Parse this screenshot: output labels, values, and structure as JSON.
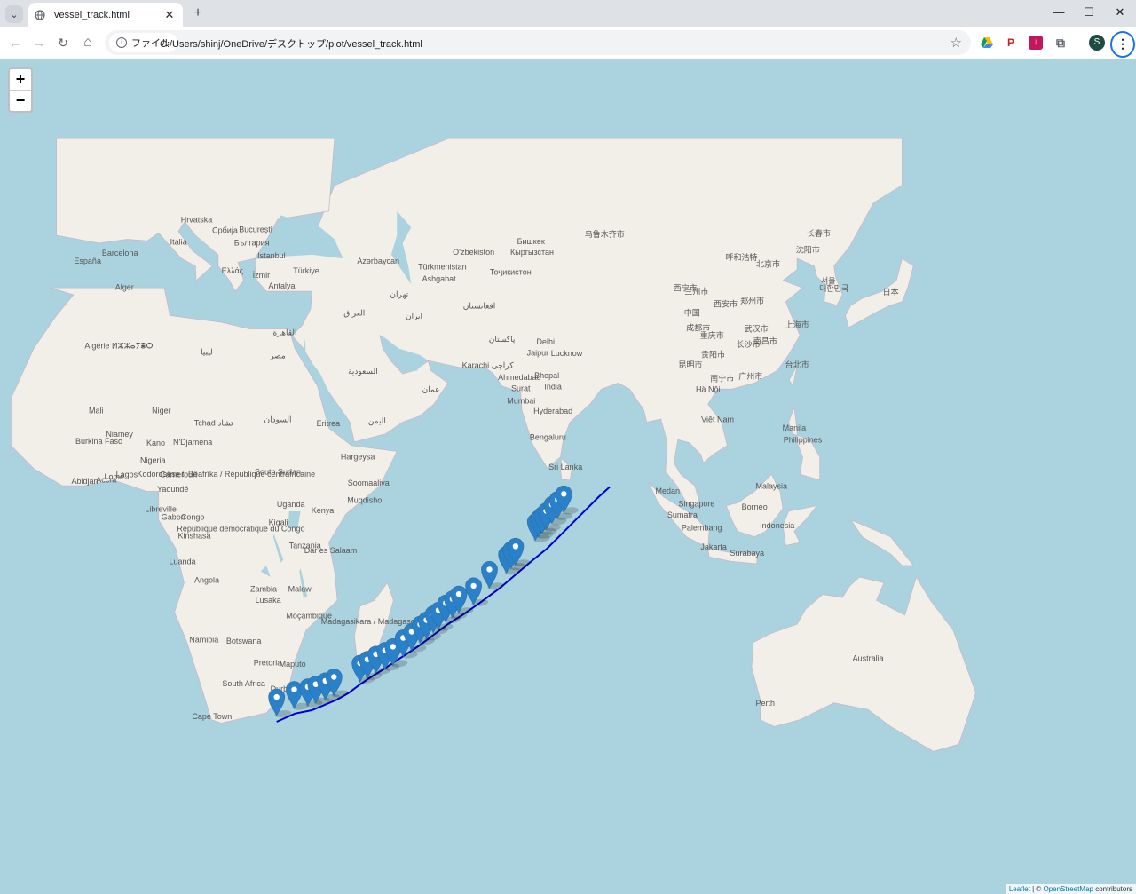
{
  "browser": {
    "tab_title": "vessel_track.html",
    "tab_close": "✕",
    "new_tab": "+",
    "tab_list": "⌄",
    "minimize": "—",
    "maximize": "☐",
    "close": "✕",
    "nav": {
      "back": "←",
      "forward": "→",
      "reload": "↻",
      "home": "⌂"
    },
    "chip_label": "ファイル",
    "url": "C:/Users/shinj/OneDrive/デスクトップ/plot/vessel_track.html",
    "star": "☆",
    "profile_initial": "S",
    "menu": "⋮"
  },
  "map": {
    "zoom_in": "+",
    "zoom_out": "−",
    "attribution": {
      "leaflet": "Leaflet",
      "sep": " | © ",
      "osm": "OpenStreetMap",
      "rest": " contributors"
    },
    "track_color": "#0000cc",
    "marker_color": "#2a81cb",
    "track": [
      {
        "lat": -34.3,
        "lon": 29.8
      },
      {
        "lat": -33.1,
        "lon": 33.0
      },
      {
        "lat": -32.6,
        "lon": 36.0
      },
      {
        "lat": -31.9,
        "lon": 38.0
      },
      {
        "lat": -31.0,
        "lon": 40.5
      },
      {
        "lat": -30.0,
        "lon": 42.5
      },
      {
        "lat": -28.7,
        "lon": 44.5
      },
      {
        "lat": -27.5,
        "lon": 46.5
      },
      {
        "lat": -26.4,
        "lon": 48.5
      },
      {
        "lat": -25.2,
        "lon": 50.5
      },
      {
        "lat": -24.0,
        "lon": 52.5
      },
      {
        "lat": -22.8,
        "lon": 54.5
      },
      {
        "lat": -21.6,
        "lon": 56.3
      },
      {
        "lat": -20.4,
        "lon": 58.0
      },
      {
        "lat": -19.0,
        "lon": 60.0
      },
      {
        "lat": -17.5,
        "lon": 62.5
      },
      {
        "lat": -15.5,
        "lon": 65.5
      },
      {
        "lat": -13.0,
        "lon": 69.0
      },
      {
        "lat": -10.5,
        "lon": 72.0
      },
      {
        "lat": -8.0,
        "lon": 75.0
      },
      {
        "lat": -6.0,
        "lon": 77.5
      },
      {
        "lat": -3.0,
        "lon": 80.5
      },
      {
        "lat": -1.0,
        "lon": 82.5
      },
      {
        "lat": 1.0,
        "lon": 84.5
      },
      {
        "lat": 3.0,
        "lon": 86.5
      },
      {
        "lat": 4.8,
        "lon": 88.5
      }
    ],
    "markers": [
      {
        "lat": -33.4,
        "lon": 29.8
      },
      {
        "lat": -32.3,
        "lon": 32.9
      },
      {
        "lat": -31.9,
        "lon": 35.3
      },
      {
        "lat": -31.5,
        "lon": 36.7
      },
      {
        "lat": -31.0,
        "lon": 38.4
      },
      {
        "lat": -30.4,
        "lon": 39.9
      },
      {
        "lat": -28.3,
        "lon": 44.5
      },
      {
        "lat": -27.7,
        "lon": 45.8
      },
      {
        "lat": -26.9,
        "lon": 47.3
      },
      {
        "lat": -26.3,
        "lon": 48.9
      },
      {
        "lat": -25.7,
        "lon": 50.3
      },
      {
        "lat": -24.3,
        "lon": 52.1
      },
      {
        "lat": -23.3,
        "lon": 53.6
      },
      {
        "lat": -22.1,
        "lon": 55.1
      },
      {
        "lat": -21.4,
        "lon": 56.2
      },
      {
        "lat": -20.4,
        "lon": 57.4
      },
      {
        "lat": -19.8,
        "lon": 58.3
      },
      {
        "lat": -18.6,
        "lon": 59.6
      },
      {
        "lat": -17.9,
        "lon": 60.8
      },
      {
        "lat": -17.1,
        "lon": 61.9
      },
      {
        "lat": -15.7,
        "lon": 64.5
      },
      {
        "lat": -12.9,
        "lon": 67.3
      },
      {
        "lat": -10.3,
        "lon": 70.3
      },
      {
        "lat": -9.5,
        "lon": 71.1
      },
      {
        "lat": -8.9,
        "lon": 71.9
      },
      {
        "lat": -4.6,
        "lon": 75.4
      },
      {
        "lat": -4.0,
        "lon": 76.0
      },
      {
        "lat": -3.4,
        "lon": 76.6
      },
      {
        "lat": -2.7,
        "lon": 77.3
      },
      {
        "lat": -1.6,
        "lon": 78.3
      },
      {
        "lat": -0.7,
        "lon": 79.3
      },
      {
        "lat": 0.3,
        "lon": 80.4
      }
    ],
    "labels": [
      {
        "t": "España",
        "lat": 40.3,
        "lon": -3.5
      },
      {
        "t": "Barcelona",
        "lat": 41.4,
        "lon": 2.2
      },
      {
        "t": "Italia",
        "lat": 42.8,
        "lon": 12.5
      },
      {
        "t": "Hrvatska",
        "lat": 45.6,
        "lon": 15.7
      },
      {
        "t": "Србија",
        "lat": 44.3,
        "lon": 20.7
      },
      {
        "t": "Bucureşti",
        "lat": 44.4,
        "lon": 26.1
      },
      {
        "t": "България",
        "lat": 42.7,
        "lon": 25.4
      },
      {
        "t": "Istanbul",
        "lat": 41.0,
        "lon": 28.9
      },
      {
        "t": "Ελλάς",
        "lat": 39.0,
        "lon": 22.0
      },
      {
        "t": "İzmir",
        "lat": 38.4,
        "lon": 27.1
      },
      {
        "t": "Antalya",
        "lat": 36.9,
        "lon": 30.7
      },
      {
        "t": "Türkiye",
        "lat": 39.0,
        "lon": 35.0
      },
      {
        "t": "Azərbaycan",
        "lat": 40.3,
        "lon": 47.7
      },
      {
        "t": "Türkmenistan",
        "lat": 39.5,
        "lon": 59.0
      },
      {
        "t": "Oʻzbekiston",
        "lat": 41.5,
        "lon": 64.5
      },
      {
        "t": "Ashgabat",
        "lat": 37.9,
        "lon": 58.4
      },
      {
        "t": "Тоҷикистон",
        "lat": 38.8,
        "lon": 71.0
      },
      {
        "t": "Кыргызстан",
        "lat": 41.5,
        "lon": 74.8
      },
      {
        "t": "Бишкек",
        "lat": 42.9,
        "lon": 74.6
      },
      {
        "t": "Alger",
        "lat": 36.7,
        "lon": 3.0
      },
      {
        "t": "Algérie ⵍⵣⵣⴰⵢⴻⵔ",
        "lat": 28.0,
        "lon": 2.0
      },
      {
        "t": "Mali",
        "lat": 17.5,
        "lon": -2.0
      },
      {
        "t": "Niger",
        "lat": 17.5,
        "lon": 9.5
      },
      {
        "t": "Niamey",
        "lat": 13.5,
        "lon": 2.1
      },
      {
        "t": "Burkina Faso",
        "lat": 12.3,
        "lon": -1.5
      },
      {
        "t": "Kano",
        "lat": 12.0,
        "lon": 8.5
      },
      {
        "t": "N'Djaména",
        "lat": 12.1,
        "lon": 15.0
      },
      {
        "t": "Tchad تشاد",
        "lat": 15.4,
        "lon": 18.7
      },
      {
        "t": "Nigeria",
        "lat": 9.0,
        "lon": 8.0
      },
      {
        "t": "Lagos",
        "lat": 6.5,
        "lon": 3.4
      },
      {
        "t": "Lomé",
        "lat": 6.1,
        "lon": 1.2
      },
      {
        "t": "Accra",
        "lat": 5.6,
        "lon": -0.2
      },
      {
        "t": "Abidjan",
        "lat": 5.3,
        "lon": -4.0
      },
      {
        "t": "Cameroun",
        "lat": 6.5,
        "lon": 12.5
      },
      {
        "t": "Yaoundé",
        "lat": 3.9,
        "lon": 11.5
      },
      {
        "t": "Libreville",
        "lat": 0.4,
        "lon": 9.4
      },
      {
        "t": "Gabon",
        "lat": -1.0,
        "lon": 11.6
      },
      {
        "t": "Congo",
        "lat": -1.0,
        "lon": 15.0
      },
      {
        "t": "Kinshasa",
        "lat": -4.3,
        "lon": 15.3
      },
      {
        "t": "Luanda",
        "lat": -8.8,
        "lon": 13.2
      },
      {
        "t": "Angola",
        "lat": -12.0,
        "lon": 17.5
      },
      {
        "t": "Zambia",
        "lat": -13.5,
        "lon": 27.5
      },
      {
        "t": "Lusaka",
        "lat": -15.4,
        "lon": 28.3
      },
      {
        "t": "Malawi",
        "lat": -13.5,
        "lon": 34.0
      },
      {
        "t": "Moçambique",
        "lat": -18.0,
        "lon": 35.5
      },
      {
        "t": "Namibia",
        "lat": -22.0,
        "lon": 17.0
      },
      {
        "t": "Botswana",
        "lat": -22.2,
        "lon": 24.0
      },
      {
        "t": "Pretoria",
        "lat": -25.7,
        "lon": 28.2
      },
      {
        "t": "Maputo",
        "lat": -25.9,
        "lon": 32.6
      },
      {
        "t": "South Africa",
        "lat": -29.0,
        "lon": 24.0
      },
      {
        "t": "Durban",
        "lat": -29.8,
        "lon": 31.0
      },
      {
        "t": "Cape Town",
        "lat": -33.9,
        "lon": 18.4
      },
      {
        "t": "Madagasikara / Madagascar",
        "lat": -19.0,
        "lon": 46.5
      },
      {
        "t": "Kigali",
        "lat": -1.9,
        "lon": 30.1
      },
      {
        "t": "Tanzania",
        "lat": -6.0,
        "lon": 34.8
      },
      {
        "t": "Dar es Salaam",
        "lat": -6.8,
        "lon": 39.3
      },
      {
        "t": "Kenya",
        "lat": 0.2,
        "lon": 37.9
      },
      {
        "t": "Uganda",
        "lat": 1.3,
        "lon": 32.3
      },
      {
        "t": "South Sudan",
        "lat": 7.0,
        "lon": 30.0
      },
      {
        "t": "Eritrea",
        "lat": 15.3,
        "lon": 38.9
      },
      {
        "t": "Hargeysa",
        "lat": 9.6,
        "lon": 44.1
      },
      {
        "t": "Soomaaliya",
        "lat": 5.0,
        "lon": 46.0
      },
      {
        "t": "Muqdisho",
        "lat": 2.0,
        "lon": 45.3
      },
      {
        "t": "Delhi",
        "lat": 28.6,
        "lon": 77.2
      },
      {
        "t": "Jaipur",
        "lat": 26.9,
        "lon": 75.8
      },
      {
        "t": "Lucknow",
        "lat": 26.8,
        "lon": 80.9
      },
      {
        "t": "Ahmedabad",
        "lat": 23.0,
        "lon": 72.6
      },
      {
        "t": "Bhopal",
        "lat": 23.3,
        "lon": 77.4
      },
      {
        "t": "India",
        "lat": 21.5,
        "lon": 78.5
      },
      {
        "t": "Surat",
        "lat": 21.2,
        "lon": 72.8
      },
      {
        "t": "Mumbai",
        "lat": 19.1,
        "lon": 72.9
      },
      {
        "t": "Hyderabad",
        "lat": 17.4,
        "lon": 78.5
      },
      {
        "t": "Bengaluru",
        "lat": 12.97,
        "lon": 77.6
      },
      {
        "t": "Sri Lanka",
        "lat": 7.8,
        "lon": 80.7
      },
      {
        "t": "中国",
        "lat": 33.0,
        "lon": 103.0
      },
      {
        "t": "Việt Nam",
        "lat": 16.0,
        "lon": 107.5
      },
      {
        "t": "Hà Nội",
        "lat": 21.0,
        "lon": 105.8
      },
      {
        "t": "Manila",
        "lat": 14.6,
        "lon": 121.0
      },
      {
        "t": "Philippines",
        "lat": 12.5,
        "lon": 122.5
      },
      {
        "t": "Malaysia",
        "lat": 4.5,
        "lon": 117.0
      },
      {
        "t": "Medan",
        "lat": 3.6,
        "lon": 98.7
      },
      {
        "t": "Singapore",
        "lat": 1.35,
        "lon": 103.8
      },
      {
        "t": "Sumatra",
        "lat": -0.6,
        "lon": 101.3
      },
      {
        "t": "Borneo",
        "lat": 0.8,
        "lon": 114.0
      },
      {
        "t": "Palembang",
        "lat": -2.9,
        "lon": 104.7
      },
      {
        "t": "Indonesia",
        "lat": -2.5,
        "lon": 118.0
      },
      {
        "t": "Jakarta",
        "lat": -6.2,
        "lon": 106.8
      },
      {
        "t": "Surabaya",
        "lat": -7.3,
        "lon": 112.7
      },
      {
        "t": "Australia",
        "lat": -25.0,
        "lon": 134.0
      },
      {
        "t": "Perth",
        "lat": -31.95,
        "lon": 115.9
      },
      {
        "t": "北京市",
        "lat": 39.9,
        "lon": 116.4
      },
      {
        "t": "上海市",
        "lat": 31.2,
        "lon": 121.5
      },
      {
        "t": "重庆市",
        "lat": 29.6,
        "lon": 106.5
      },
      {
        "t": "成都市",
        "lat": 30.7,
        "lon": 104.1
      },
      {
        "t": "昆明市",
        "lat": 25.0,
        "lon": 102.7
      },
      {
        "t": "南宁市",
        "lat": 22.8,
        "lon": 108.3
      },
      {
        "t": "广州市",
        "lat": 23.1,
        "lon": 113.3
      },
      {
        "t": "台北市",
        "lat": 25.0,
        "lon": 121.5
      },
      {
        "t": "日本",
        "lat": 36.0,
        "lon": 138.0
      },
      {
        "t": "대한민국",
        "lat": 36.5,
        "lon": 128.0
      },
      {
        "t": "서울",
        "lat": 37.6,
        "lon": 127.0
      },
      {
        "t": "长春市",
        "lat": 43.9,
        "lon": 125.3
      },
      {
        "t": "沈阳市",
        "lat": 41.8,
        "lon": 123.4
      },
      {
        "t": "乌鲁木齐市",
        "lat": 43.8,
        "lon": 87.6
      },
      {
        "t": "呼和浩特",
        "lat": 40.8,
        "lon": 111.7
      },
      {
        "t": "西宁市",
        "lat": 36.6,
        "lon": 101.8
      },
      {
        "t": "兰州市",
        "lat": 36.1,
        "lon": 103.8
      },
      {
        "t": "西安市",
        "lat": 34.3,
        "lon": 108.9
      },
      {
        "t": "郑州市",
        "lat": 34.75,
        "lon": 113.6
      },
      {
        "t": "武汉市",
        "lat": 30.6,
        "lon": 114.3
      },
      {
        "t": "长沙市",
        "lat": 28.2,
        "lon": 112.9
      },
      {
        "t": "南昌市",
        "lat": 28.7,
        "lon": 115.9
      },
      {
        "t": "贵阳市",
        "lat": 26.6,
        "lon": 106.7
      },
      {
        "t": "Karachi کراچی",
        "lat": 24.9,
        "lon": 67.0
      },
      {
        "t": "پاکستان",
        "lat": 29.0,
        "lon": 69.5
      },
      {
        "t": "افغانستان",
        "lat": 34.0,
        "lon": 65.5
      },
      {
        "t": "ایران",
        "lat": 32.5,
        "lon": 54.0
      },
      {
        "t": "تهران",
        "lat": 35.7,
        "lon": 51.4
      },
      {
        "t": "العراق",
        "lat": 33.0,
        "lon": 43.5
      },
      {
        "t": "السعودية",
        "lat": 24.0,
        "lon": 45.0
      },
      {
        "t": "مصر",
        "lat": 26.5,
        "lon": 30.0
      },
      {
        "t": "ليبيا",
        "lat": 27.0,
        "lon": 17.5
      },
      {
        "t": "السودان",
        "lat": 16.0,
        "lon": 30.0
      },
      {
        "t": "عمان",
        "lat": 21.0,
        "lon": 57.0
      },
      {
        "t": "اليمن",
        "lat": 15.8,
        "lon": 47.5
      },
      {
        "t": "القاهرة",
        "lat": 30.05,
        "lon": 31.25
      },
      {
        "t": "Kodorosêse ti Bêafrîka / République centrafricaine",
        "lat": 6.6,
        "lon": 20.9
      },
      {
        "t": "République démocratique du Congo",
        "lat": -3.0,
        "lon": 23.5
      }
    ]
  }
}
